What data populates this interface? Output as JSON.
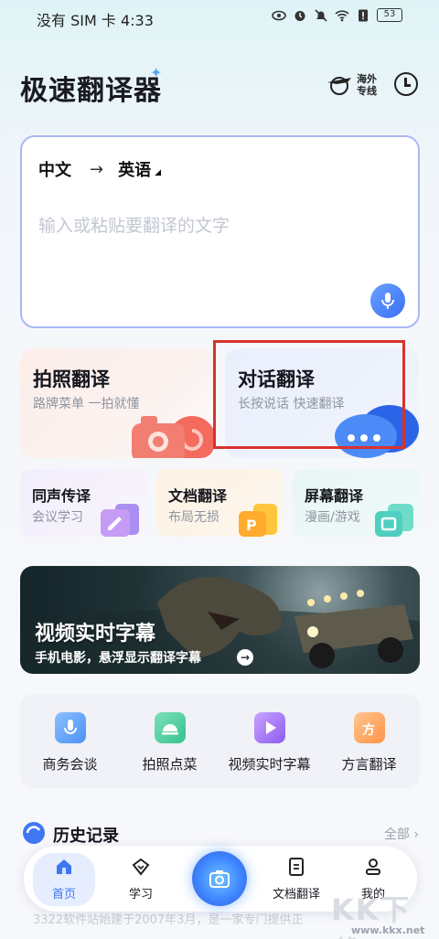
{
  "status_bar": {
    "carrier_time": "没有 SIM 卡 4:33",
    "battery": "53"
  },
  "header": {
    "title": "极速翻译器",
    "overseas_line1": "海外",
    "overseas_line2": "专线"
  },
  "input": {
    "source_lang": "中文",
    "arrow": "→",
    "target_lang": "英语",
    "placeholder": "输入或粘贴要翻译的文字"
  },
  "features": [
    {
      "title": "拍照翻译",
      "subtitle": "路牌菜单 一拍就懂"
    },
    {
      "title": "对话翻译",
      "subtitle": "长按说话 快速翻译"
    }
  ],
  "small_features": [
    {
      "title": "同声传译",
      "subtitle": "会议学习"
    },
    {
      "title": "文档翻译",
      "subtitle": "布局无损"
    },
    {
      "title": "屏幕翻译",
      "subtitle": "漫画/游戏"
    }
  ],
  "banner": {
    "title": "视频实时字幕",
    "subtitle": "手机电影，悬浮显示翻译字幕"
  },
  "shortcuts": [
    {
      "label": "商务会谈"
    },
    {
      "label": "拍照点菜"
    },
    {
      "label": "视频实时字幕"
    },
    {
      "label": "方言翻译"
    }
  ],
  "history": {
    "title": "历史记录",
    "all_label": "全部"
  },
  "bottom_nav": [
    {
      "label": "首页"
    },
    {
      "label": "学习"
    },
    {
      "label": "文档翻译"
    },
    {
      "label": "我的"
    }
  ],
  "footer_text": "3322软件站始建于2007年3月，是一家专门提供正",
  "watermark": {
    "text": "KK下载",
    "url": "www.kkx.net"
  },
  "colors": {
    "accent": "#3f78f2",
    "highlight": "#d9322e"
  }
}
